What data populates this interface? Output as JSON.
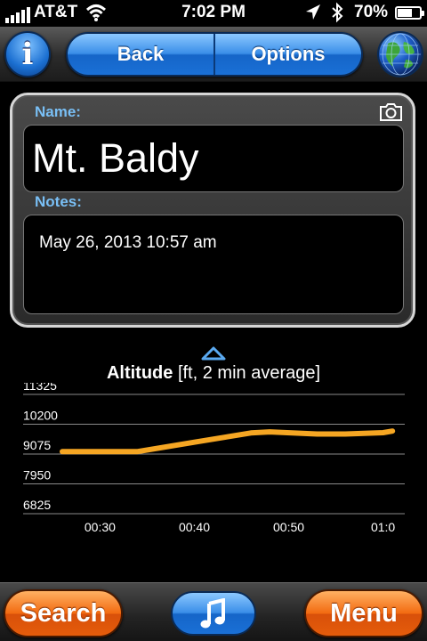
{
  "status_bar": {
    "carrier": "AT&T",
    "time": "7:02 PM",
    "battery_percent": "70%",
    "battery_level": 0.7,
    "icons": [
      "signal-icon",
      "wifi-icon",
      "location-arrow-icon",
      "bluetooth-icon",
      "battery-icon"
    ]
  },
  "nav": {
    "info_label": "i",
    "back_label": "Back",
    "options_label": "Options",
    "icons": [
      "info-icon",
      "globe-icon"
    ]
  },
  "detail": {
    "name_label": "Name:",
    "name_value": "Mt. Baldy",
    "notes_label": "Notes:",
    "notes_value": "May 26, 2013 10:57 am",
    "icons": [
      "camera-icon"
    ]
  },
  "chart_title": {
    "bold": "Altitude",
    "rest": " [ft, 2 min average]"
  },
  "chart_data": {
    "type": "line",
    "title": "Altitude [ft, 2 min average]",
    "yticks": [
      "11325",
      "10200",
      "9075",
      "7950",
      "6825"
    ],
    "ylim": [
      6825,
      11325
    ],
    "xticks": [
      "00:30",
      "00:40",
      "00:50",
      "01:0"
    ],
    "grid": true,
    "series": [
      {
        "color": "#f5a623",
        "points": [
          [
            "00:26",
            9170
          ],
          [
            "00:34",
            9170
          ],
          [
            "00:40",
            9520
          ],
          [
            "00:46",
            9870
          ],
          [
            "00:48",
            9910
          ],
          [
            "00:53",
            9830
          ],
          [
            "00:56",
            9830
          ],
          [
            "01:00",
            9880
          ],
          [
            "01:01",
            9940
          ]
        ]
      }
    ]
  },
  "toolbar": {
    "search_label": "Search",
    "menu_label": "Menu",
    "icons": [
      "music-note-icon"
    ]
  },
  "colors": {
    "accent_blue": "#2b82e0",
    "accent_orange": "#f26a10",
    "label_blue": "#79bff5",
    "line_orange": "#f5a623"
  }
}
